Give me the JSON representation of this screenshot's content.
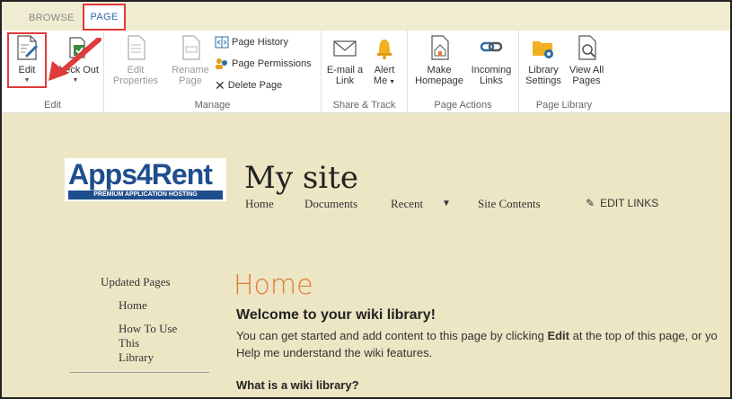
{
  "tabs": {
    "browse": "BROWSE",
    "page": "PAGE"
  },
  "ribbon": {
    "edit_group": {
      "label": "Edit",
      "edit": "Edit",
      "checkout": "Check Out"
    },
    "manage_group": {
      "label": "Manage",
      "edit_properties_1": "Edit",
      "edit_properties_2": "Properties",
      "rename_1": "Rename",
      "rename_2": "Page",
      "page_history": "Page History",
      "page_permissions": "Page Permissions",
      "delete_page": "Delete Page"
    },
    "share_group": {
      "label": "Share & Track",
      "email_1": "E-mail a",
      "email_2": "Link",
      "alert_1": "Alert",
      "alert_2": "Me"
    },
    "page_actions_group": {
      "label": "Page Actions",
      "make_1": "Make",
      "make_2": "Homepage",
      "incoming_1": "Incoming",
      "incoming_2": "Links"
    },
    "library_group": {
      "label": "Page Library",
      "settings_1": "Library",
      "settings_2": "Settings",
      "viewall_1": "View All",
      "viewall_2": "Pages"
    }
  },
  "header": {
    "logo_text": "Apps4Rent",
    "logo_sub": "PREMIUM APPLICATION HOSTING",
    "site_title": "My site",
    "nav": [
      "Home",
      "Documents",
      "Recent",
      "Site Contents"
    ],
    "edit_links": "EDIT LINKS"
  },
  "left_nav": {
    "heading": "Updated Pages",
    "items": [
      "Home",
      "How To Use",
      "This",
      "Library"
    ]
  },
  "content": {
    "title": "Home",
    "welcome": "Welcome to your wiki library!",
    "line1_pre": "You can get started and add content to this page by clicking ",
    "line1_bold": "Edit",
    "line1_post": " at the top of this page, or yo",
    "line2": "Help me understand the wiki features.",
    "what_is": "What is a wiki library?"
  },
  "colors": {
    "highlight": "#e03a3a",
    "accent": "#e07b3a",
    "link_blue": "#2b6ca8"
  }
}
